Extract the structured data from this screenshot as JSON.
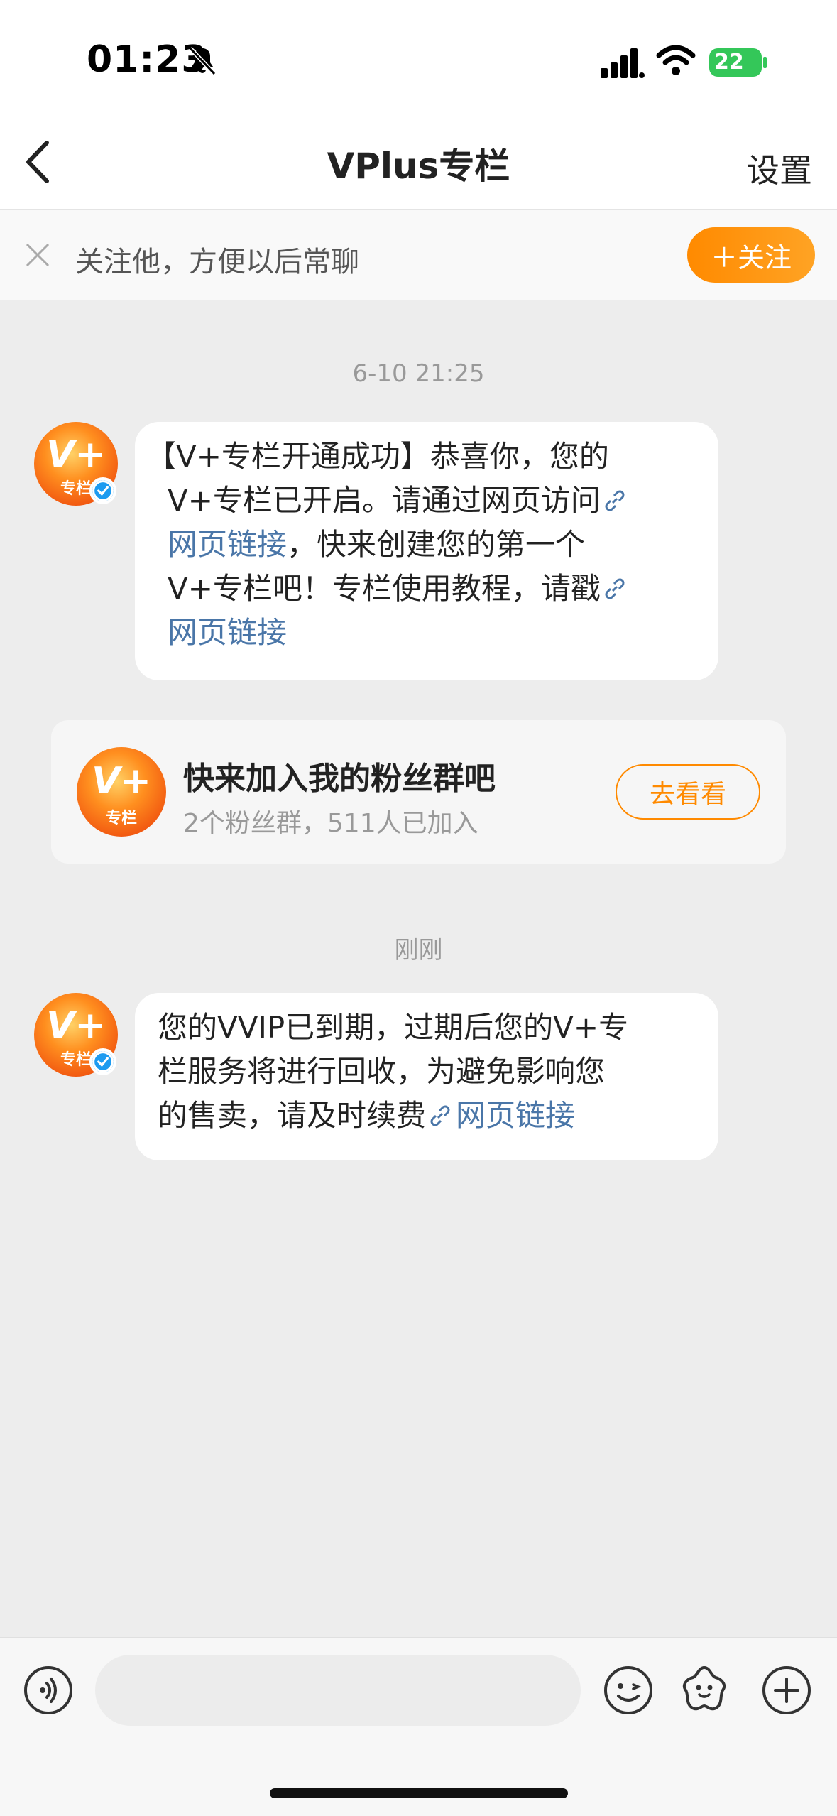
{
  "status_bar": {
    "time": "01:23",
    "battery_level": "22"
  },
  "nav": {
    "title": "VPlus专栏",
    "settings_label": "设置"
  },
  "follow_banner": {
    "text": "关注他，方便以后常聊",
    "follow_button": "＋关注"
  },
  "chat": {
    "avatar_logo_text": "V+",
    "avatar_logo_sub": "专栏",
    "timestamps": [
      "6-10 21:25",
      "刚刚"
    ],
    "message1": {
      "line1": "【V+专栏开通成功】恭喜你，您的",
      "line2_text": "V+专栏已开启。请通过网页访问",
      "link1": "网页链接",
      "line3_rest": "，快来创建您的第一个",
      "line4_text": "V+专栏吧！专栏使用教程，请戳",
      "link2": "网页链接"
    },
    "fan_group_card": {
      "title": "快来加入我的粉丝群吧",
      "subtitle": "2个粉丝群，511人已加入",
      "button": "去看看"
    },
    "message2": {
      "line1": "您的VVIP已到期，过期后您的V+专",
      "line2": "栏服务将进行回收，为避免影响您",
      "line3_text": "的售卖，请及时续费",
      "link": "网页链接"
    }
  },
  "input_bar": {
    "input_value": "",
    "icons": [
      "voice-icon",
      "emoji-icon",
      "sticker-icon",
      "plus-icon"
    ]
  },
  "colors": {
    "accent_orange": "#ff8a00",
    "link_blue": "#4a76a8",
    "verified_blue": "#1d9bf0"
  }
}
